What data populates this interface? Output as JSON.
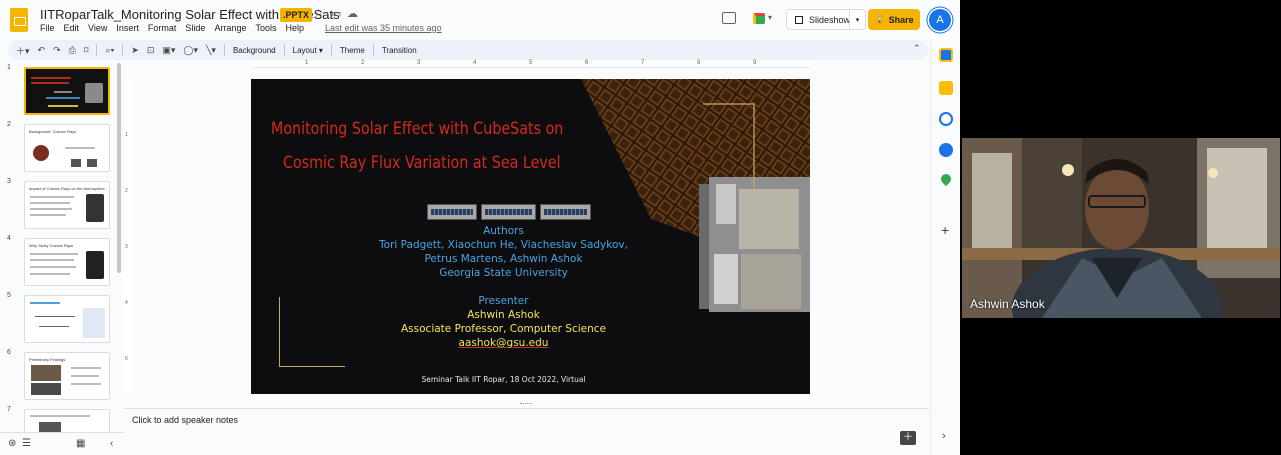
{
  "header": {
    "doc_title": "IITRoparTalk_Monitoring Solar Effect with CubeSats",
    "file_badge": ".PPTX",
    "menu": [
      "File",
      "Edit",
      "View",
      "Insert",
      "Format",
      "Slide",
      "Arrange",
      "Tools",
      "Help"
    ],
    "last_edit": "Last edit was 35 minutes ago",
    "slideshow_label": "Slideshow",
    "share_label": "Share",
    "avatar_letter": "A"
  },
  "toolbar": {
    "background_label": "Background",
    "layout_label": "Layout",
    "theme_label": "Theme",
    "transition_label": "Transition"
  },
  "ruler": {
    "top_ticks": [
      "1",
      "2",
      "3",
      "4",
      "5",
      "6",
      "7",
      "8",
      "9"
    ],
    "left_ticks": [
      "1",
      "2",
      "3",
      "4",
      "5"
    ]
  },
  "filmstrip": {
    "slides": [
      {
        "num": "1",
        "title": ""
      },
      {
        "num": "2",
        "title": "Background: Cosmic Rays"
      },
      {
        "num": "3",
        "title": "Impact of Cosmic Rays on the Atmosphere"
      },
      {
        "num": "4",
        "title": "Why Study Cosmic Rays"
      },
      {
        "num": "5",
        "title": ""
      },
      {
        "num": "6",
        "title": "Preliminary Findings"
      },
      {
        "num": "7",
        "title": ""
      }
    ]
  },
  "slide": {
    "title_line1": "Monitoring Solar Effect with CubeSats on",
    "title_line2": "Cosmic Ray Flux Variation at Sea Level",
    "authors_label": "Authors",
    "authors_line1": "Tori Padgett, Xiaochun He, Viacheslav Sadykov,",
    "authors_line2": "Petrus Martens, Ashwin Ashok",
    "authors_line3": "Georgia State University",
    "presenter_label": "Presenter",
    "presenter_name": "Ashwin Ashok",
    "presenter_title": "Associate Professor, Computer Science",
    "presenter_email": "aashok@gsu.edu",
    "seminar_line": "Seminar Talk IIT Ropar, 18 Oct 2022, Virtual"
  },
  "notes": {
    "placeholder": "Click to add speaker notes"
  },
  "video": {
    "person_name": "Ashwin Ashok"
  },
  "colors": {
    "accent_yellow": "#f4b400",
    "title_red": "#d42a1c",
    "text_blue": "#4aa3df",
    "text_yellow": "#f2e55c"
  }
}
